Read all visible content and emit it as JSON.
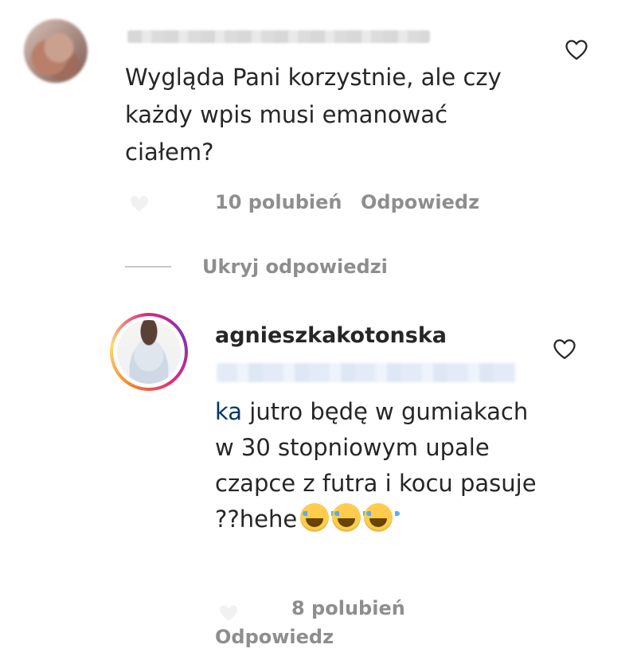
{
  "comment": {
    "text": "Wygląda Pani korzystnie, ale czy\nkażdy wpis musi emanować\nciałem?",
    "likes": "10 polubień",
    "reply_label": "Odpowiedz"
  },
  "replies_toggle": {
    "label": "Ukryj odpowiedzi"
  },
  "reply": {
    "username": "agnieszkakotonska",
    "mention": "ka",
    "text": " jutro będę w gumiakach w 30 stopniowym upale czapce z futra i kocu pasuje ??hehe",
    "emoji_name": "face-with-tears-of-joy",
    "likes": "8 polubień",
    "reply_label": "Odpowiedz"
  },
  "icons": {
    "like": "heart-outline-icon"
  },
  "colors": {
    "text": "#262626",
    "meta": "#8e8e8e",
    "mention": "#00376b"
  }
}
